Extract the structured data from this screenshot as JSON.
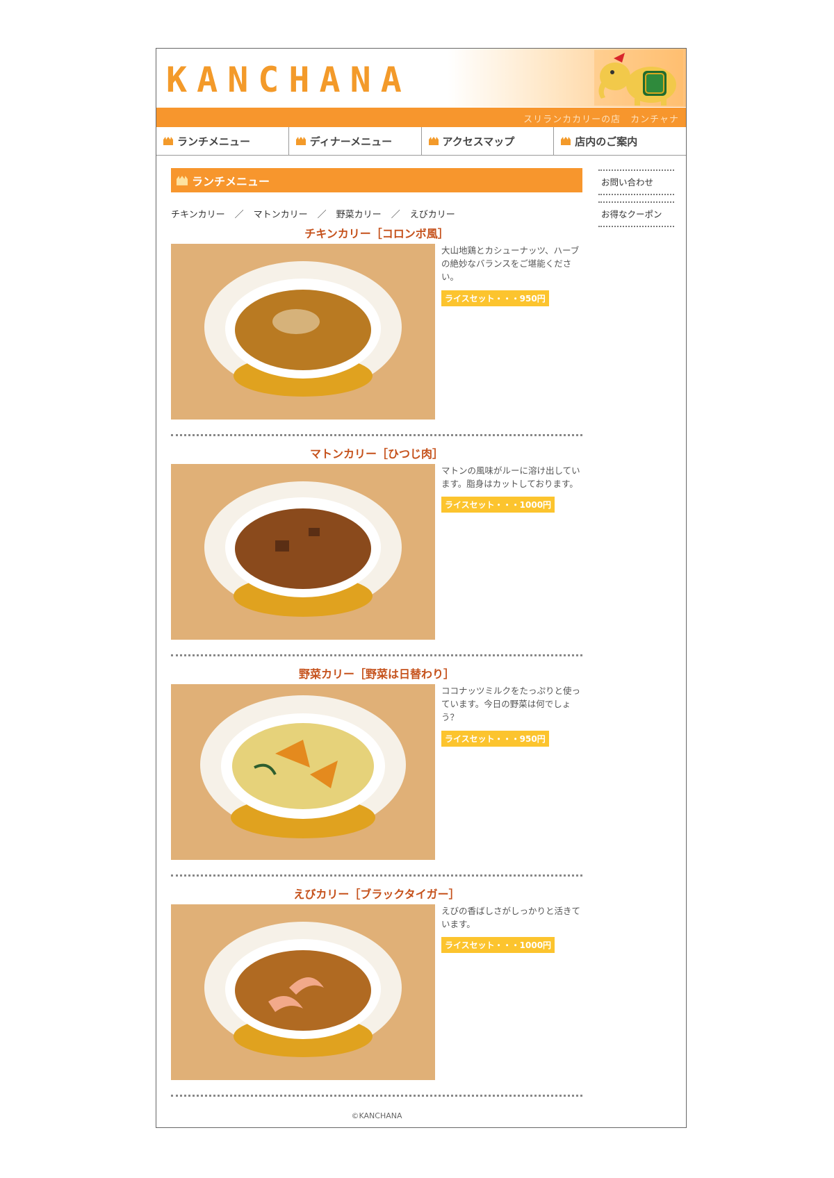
{
  "header": {
    "logo": "KANCHANA",
    "tagline": "スリランカカリーの店　カンチャナ"
  },
  "nav": [
    {
      "label": "ランチメニュー"
    },
    {
      "label": "ディナーメニュー"
    },
    {
      "label": "アクセスマップ"
    },
    {
      "label": "店内のご案内"
    }
  ],
  "main": {
    "section_title": "ランチメニュー",
    "anchors": [
      "チキンカリー",
      "マトンカリー",
      "野菜カリー",
      "えびカリー"
    ],
    "separator": "／",
    "items": [
      {
        "title": "チキンカリー［コロンボ風］",
        "desc": "大山地鶏とカシューナッツ、ハーブの絶妙なバランスをご堪能ください。",
        "price": "ライスセット・・・950円",
        "curry_color": "#b97a22"
      },
      {
        "title": "マトンカリー［ひつじ肉］",
        "desc": "マトンの風味がルーに溶け出しています。脂身はカットしております。",
        "price": "ライスセット・・・1000円",
        "curry_color": "#8a4a1c"
      },
      {
        "title": "野菜カリー［野菜は日替わり］",
        "desc": "ココナッツミルクをたっぷりと使っています。今日の野菜は何でしょう？",
        "price": "ライスセット・・・950円",
        "curry_color": "#e6d27a"
      },
      {
        "title": "えびカリー［ブラックタイガー］",
        "desc": "えびの香ばしさがしっかりと活きています。",
        "price": "ライスセット・・・1000円",
        "curry_color": "#b06a22"
      }
    ]
  },
  "sidebar": {
    "contact": "お問い合わせ",
    "coupon": "お得なクーポン"
  },
  "footer": {
    "copyright": "©KANCHANA"
  },
  "colors": {
    "accent": "#f7962d",
    "price_badge": "#fcc42e",
    "item_title": "#c5511b"
  }
}
